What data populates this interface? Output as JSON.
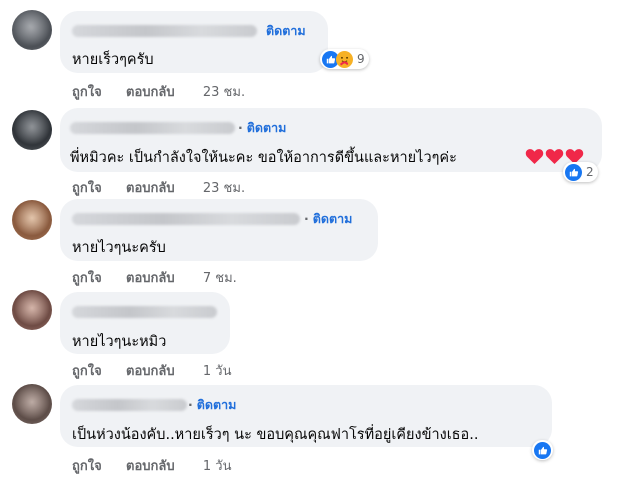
{
  "labels": {
    "follow": "ติดตาม",
    "like": "ถูกใจ",
    "reply": "ตอบกลับ"
  },
  "comments": [
    {
      "text": "หายเร็วๆครับ",
      "time": "23 ชม.",
      "reaction_count": "9",
      "reactions": [
        "like-icon",
        "care-icon"
      ]
    },
    {
      "text": "พี่หมิวคะ เป็นกำลังใจให้นะคะ ขอให้อาการดีขึ้นและหายไวๆค่ะ",
      "emoji": [
        "heart-icon",
        "heart-icon",
        "heart-icon"
      ],
      "time": "23 ชม.",
      "reaction_count": "2",
      "reactions": [
        "like-icon"
      ]
    },
    {
      "text": "หายไวๆนะครับ",
      "time": "7 ชม."
    },
    {
      "text": "หายไวๆนะหมิว",
      "time": "1 วัน"
    },
    {
      "text": "เป็นห่วงน้องคับ..หายเร็วๆ นะ ขอบคุณคุณฟาโรที่อยู่เคียงข้างเธอ..",
      "time": "1 วัน",
      "reactions": [
        "like-icon"
      ]
    }
  ],
  "colors": {
    "bubble": "#f0f2f5",
    "link": "#216fdb",
    "meta": "#65676b",
    "like": "#1877f2",
    "heart": "#f02849"
  }
}
